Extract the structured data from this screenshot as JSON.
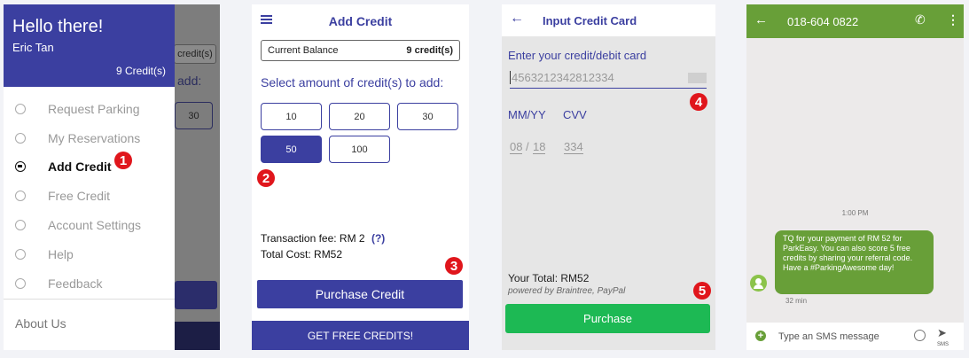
{
  "panel1": {
    "greeting": "Hello there!",
    "user_name": "Eric Tan",
    "credits": "9 Credit(s)",
    "bg_fragment_credits": "credit(s)",
    "bg_fragment_add": "add:",
    "bg_fragment_30": "30",
    "nav_items": [
      {
        "label": "Request Parking"
      },
      {
        "label": "My Reservations"
      },
      {
        "label": "Add Credit"
      },
      {
        "label": "Free Credit"
      },
      {
        "label": "Account Settings"
      },
      {
        "label": "Help"
      },
      {
        "label": "Feedback"
      }
    ],
    "about": "About Us",
    "marker": "1"
  },
  "panel2": {
    "title": "Add Credit",
    "balance_label": "Current Balance",
    "balance_value": "9 credit(s)",
    "prompt": "Select amount of credit(s) to add:",
    "options": [
      "10",
      "20",
      "30",
      "50",
      "100"
    ],
    "selected": "50",
    "fee": "Transaction fee:  RM 2",
    "fee_help": "(?)",
    "total": "Total Cost:  RM52",
    "purchase_label": "Purchase Credit",
    "free_label": "GET FREE CREDITS!",
    "marker_2": "2",
    "marker_3": "3"
  },
  "panel3": {
    "title": "Input Credit Card",
    "card_prompt": "Enter your credit/debit card",
    "card_number": "4563212342812334",
    "expiry_label": "MM/YY",
    "cvv_label": "CVV",
    "month": "08",
    "year": "18",
    "cvv": "334",
    "total": "Your Total:  RM52",
    "powered": "powered by Braintree, PayPal",
    "purchase_label": "Purchase",
    "marker_4": "4",
    "marker_5": "5"
  },
  "panel4": {
    "phone": "018-604 0822",
    "time": "1:00 PM",
    "message": "TQ for your payment of RM 52 for ParkEasy. You can also score 5 free credits by sharing your referral code. Have a #ParkingAwesome day!",
    "msg_age": "32 min",
    "input_placeholder": "Type an SMS message",
    "sms_label": "SMS"
  },
  "colors": {
    "primary": "#3b3fa0",
    "green": "#1db954",
    "sms_green": "#689f38",
    "marker_red": "#e0161c"
  }
}
